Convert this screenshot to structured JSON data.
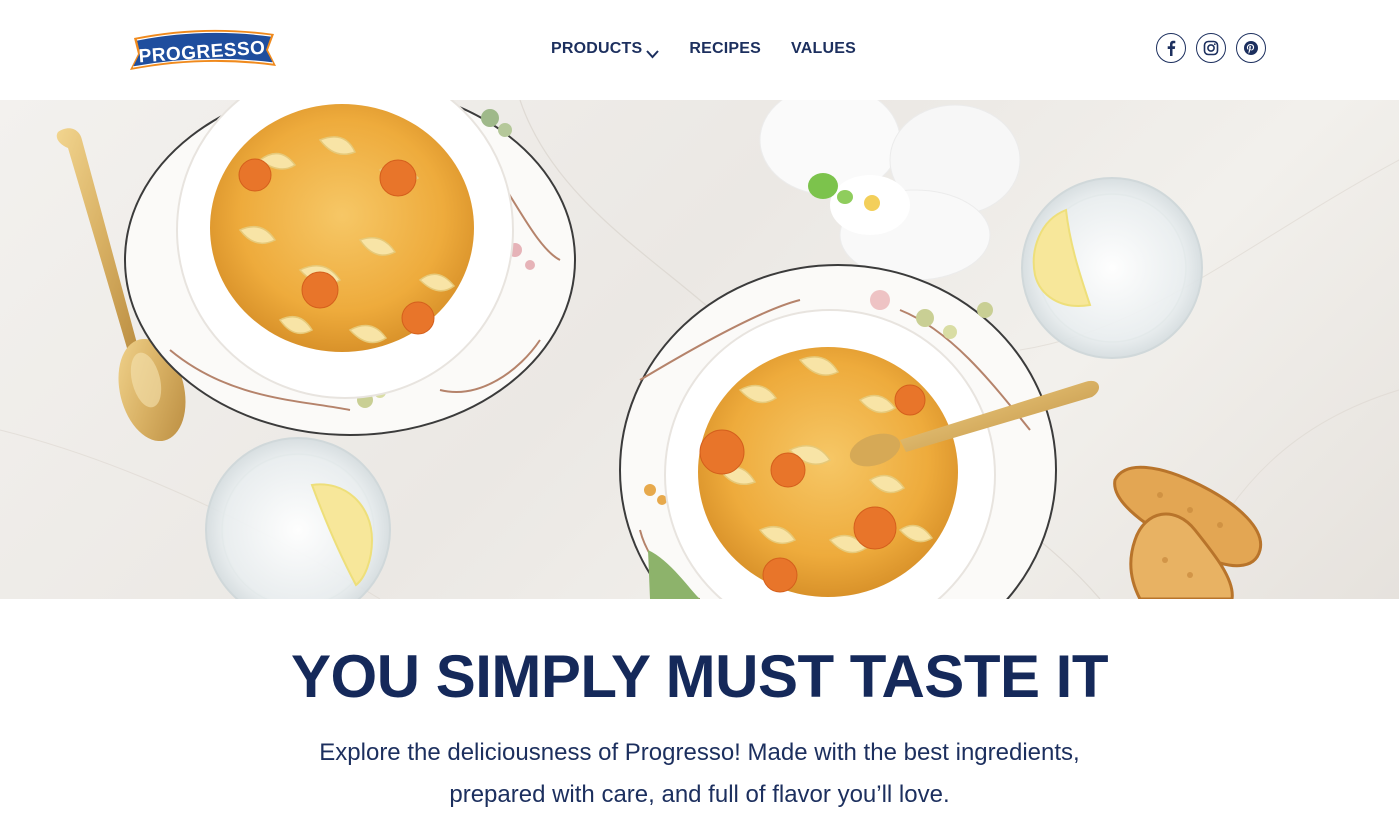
{
  "brand": {
    "logo_text": "PROGRESSO",
    "colors": {
      "navy": "#1c2f5e",
      "logo_blue": "#1f4e9e",
      "logo_orange": "#f08a1d",
      "white": "#ffffff"
    }
  },
  "nav": {
    "items": [
      {
        "label": "PRODUCTS",
        "has_dropdown": true,
        "icon": "chevron-down-icon"
      },
      {
        "label": "RECIPES"
      },
      {
        "label": "VALUES"
      }
    ]
  },
  "social": [
    {
      "name": "facebook",
      "icon": "facebook-icon"
    },
    {
      "name": "instagram",
      "icon": "instagram-icon"
    },
    {
      "name": "pinterest",
      "icon": "pinterest-icon"
    }
  ],
  "hero": {
    "image": "two bowls of chicken noodle soup on floral plates with gold spoons, water glasses with lemon, orchid and toasted bread on marble"
  },
  "content": {
    "headline": "YOU SIMPLY MUST TASTE IT",
    "subtext_line1": "Explore the deliciousness of Progresso! Made with the best ingredients,",
    "subtext_line2": "prepared with care, and full of flavor you’ll love."
  }
}
